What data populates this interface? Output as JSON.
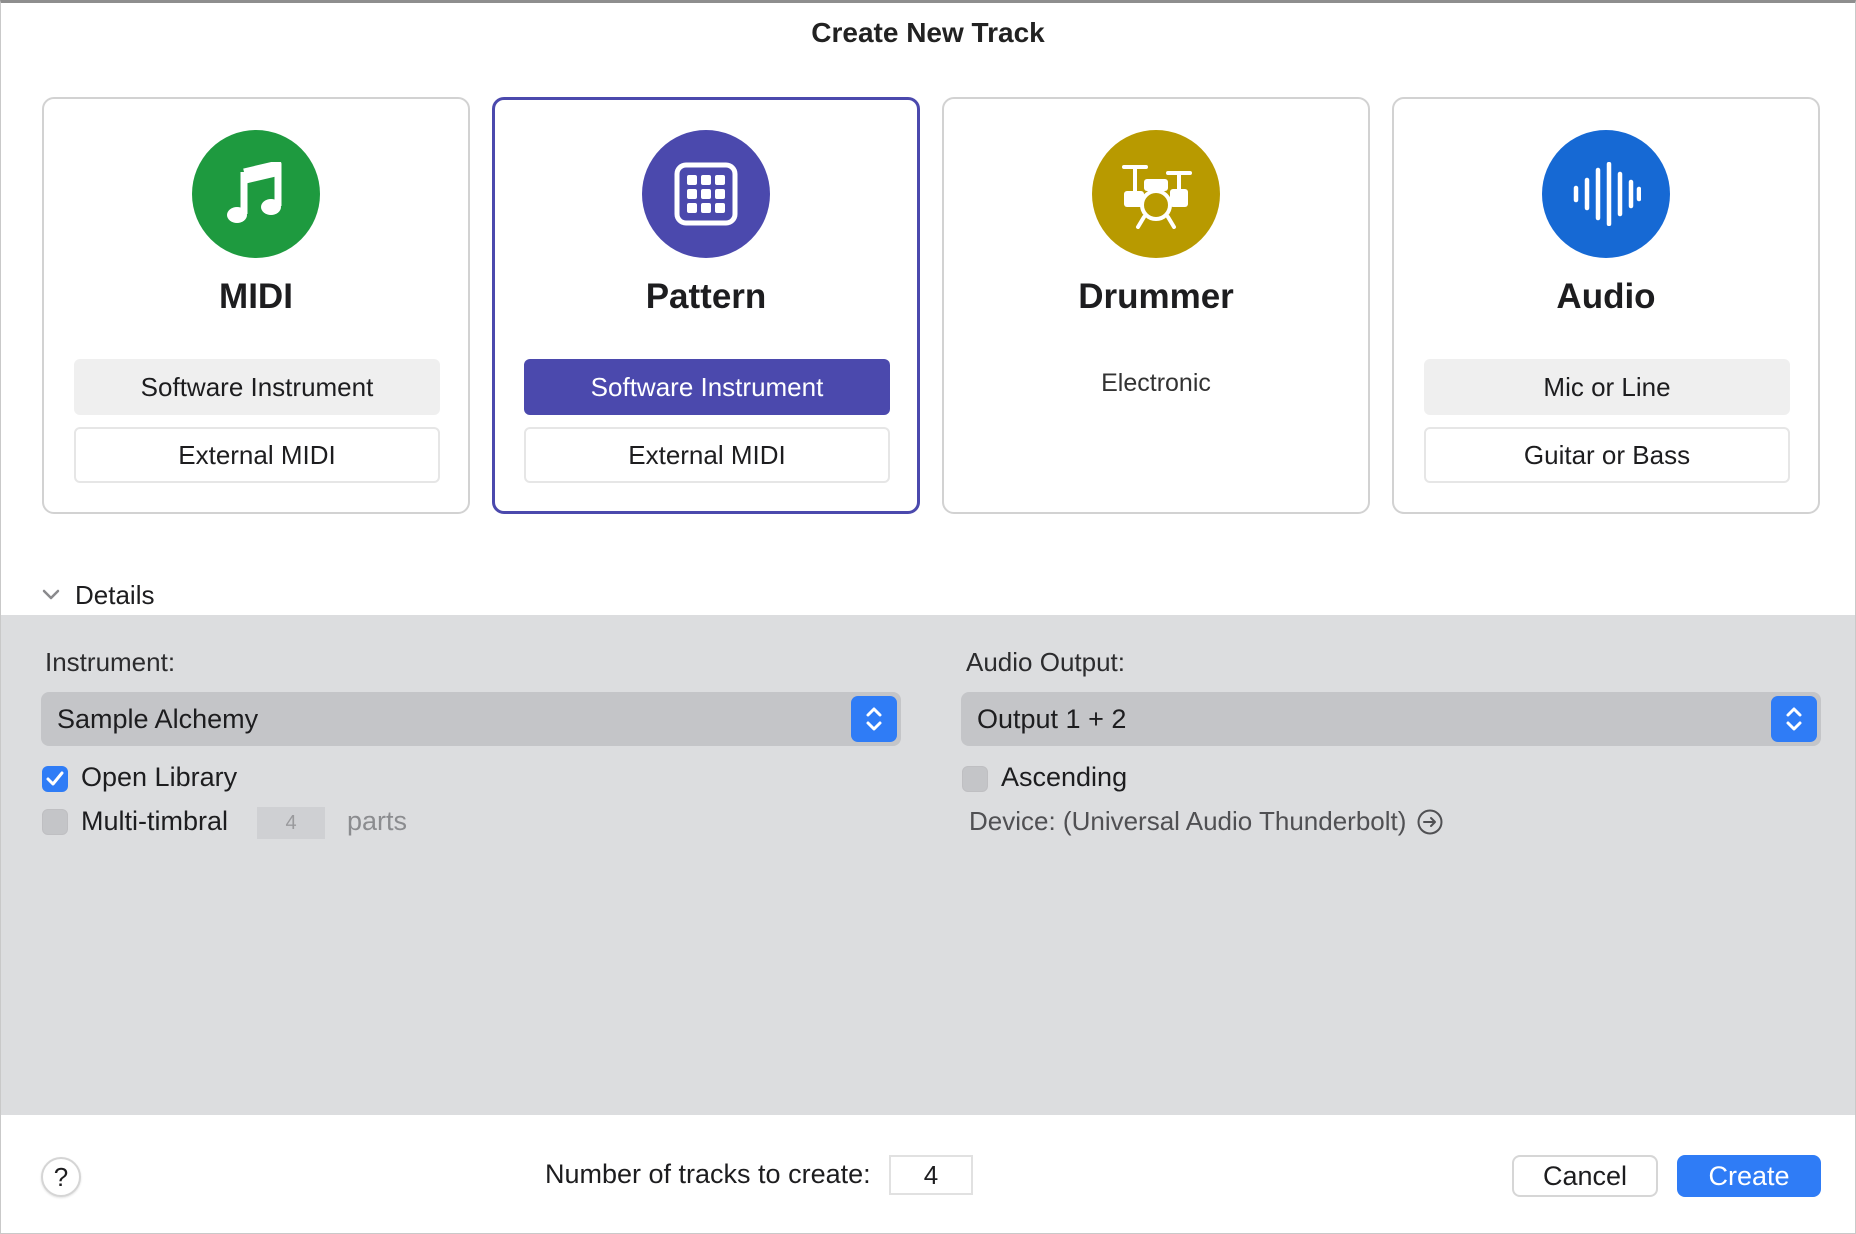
{
  "dialog": {
    "title": "Create New Track"
  },
  "cards": {
    "midi": {
      "title": "MIDI",
      "icon": "music-note-icon",
      "color": "#1e9a3f",
      "option1": "Software Instrument",
      "option2": "External MIDI"
    },
    "pattern": {
      "title": "Pattern",
      "icon": "grid-pads-icon",
      "color": "#4b49ad",
      "option1": "Software Instrument",
      "option2": "External MIDI"
    },
    "drummer": {
      "title": "Drummer",
      "icon": "drum-kit-icon",
      "color": "#b89a00",
      "option1": "Electronic"
    },
    "audio": {
      "title": "Audio",
      "icon": "waveform-icon",
      "color": "#1669d4",
      "option1": "Mic or Line",
      "option2": "Guitar or Bass"
    }
  },
  "details": {
    "toggle_label": "Details",
    "instrument_label": "Instrument:",
    "instrument_value": "Sample Alchemy",
    "open_library_label": "Open Library",
    "open_library_checked": true,
    "multitimbral_label": "Multi-timbral",
    "multitimbral_checked": false,
    "parts_value": "4",
    "parts_label": "parts",
    "audio_output_label": "Audio Output:",
    "audio_output_value": "Output 1 + 2",
    "ascending_label": "Ascending",
    "ascending_checked": false,
    "device_text": "Device: (Universal Audio Thunderbolt)"
  },
  "footer": {
    "help_label": "?",
    "count_label": "Number of tracks to create:",
    "count_value": "4",
    "cancel_label": "Cancel",
    "create_label": "Create"
  },
  "colors": {
    "accent": "#2f7cf6",
    "selected_border": "#4b49ad",
    "panel_bg": "#dcdddf"
  }
}
